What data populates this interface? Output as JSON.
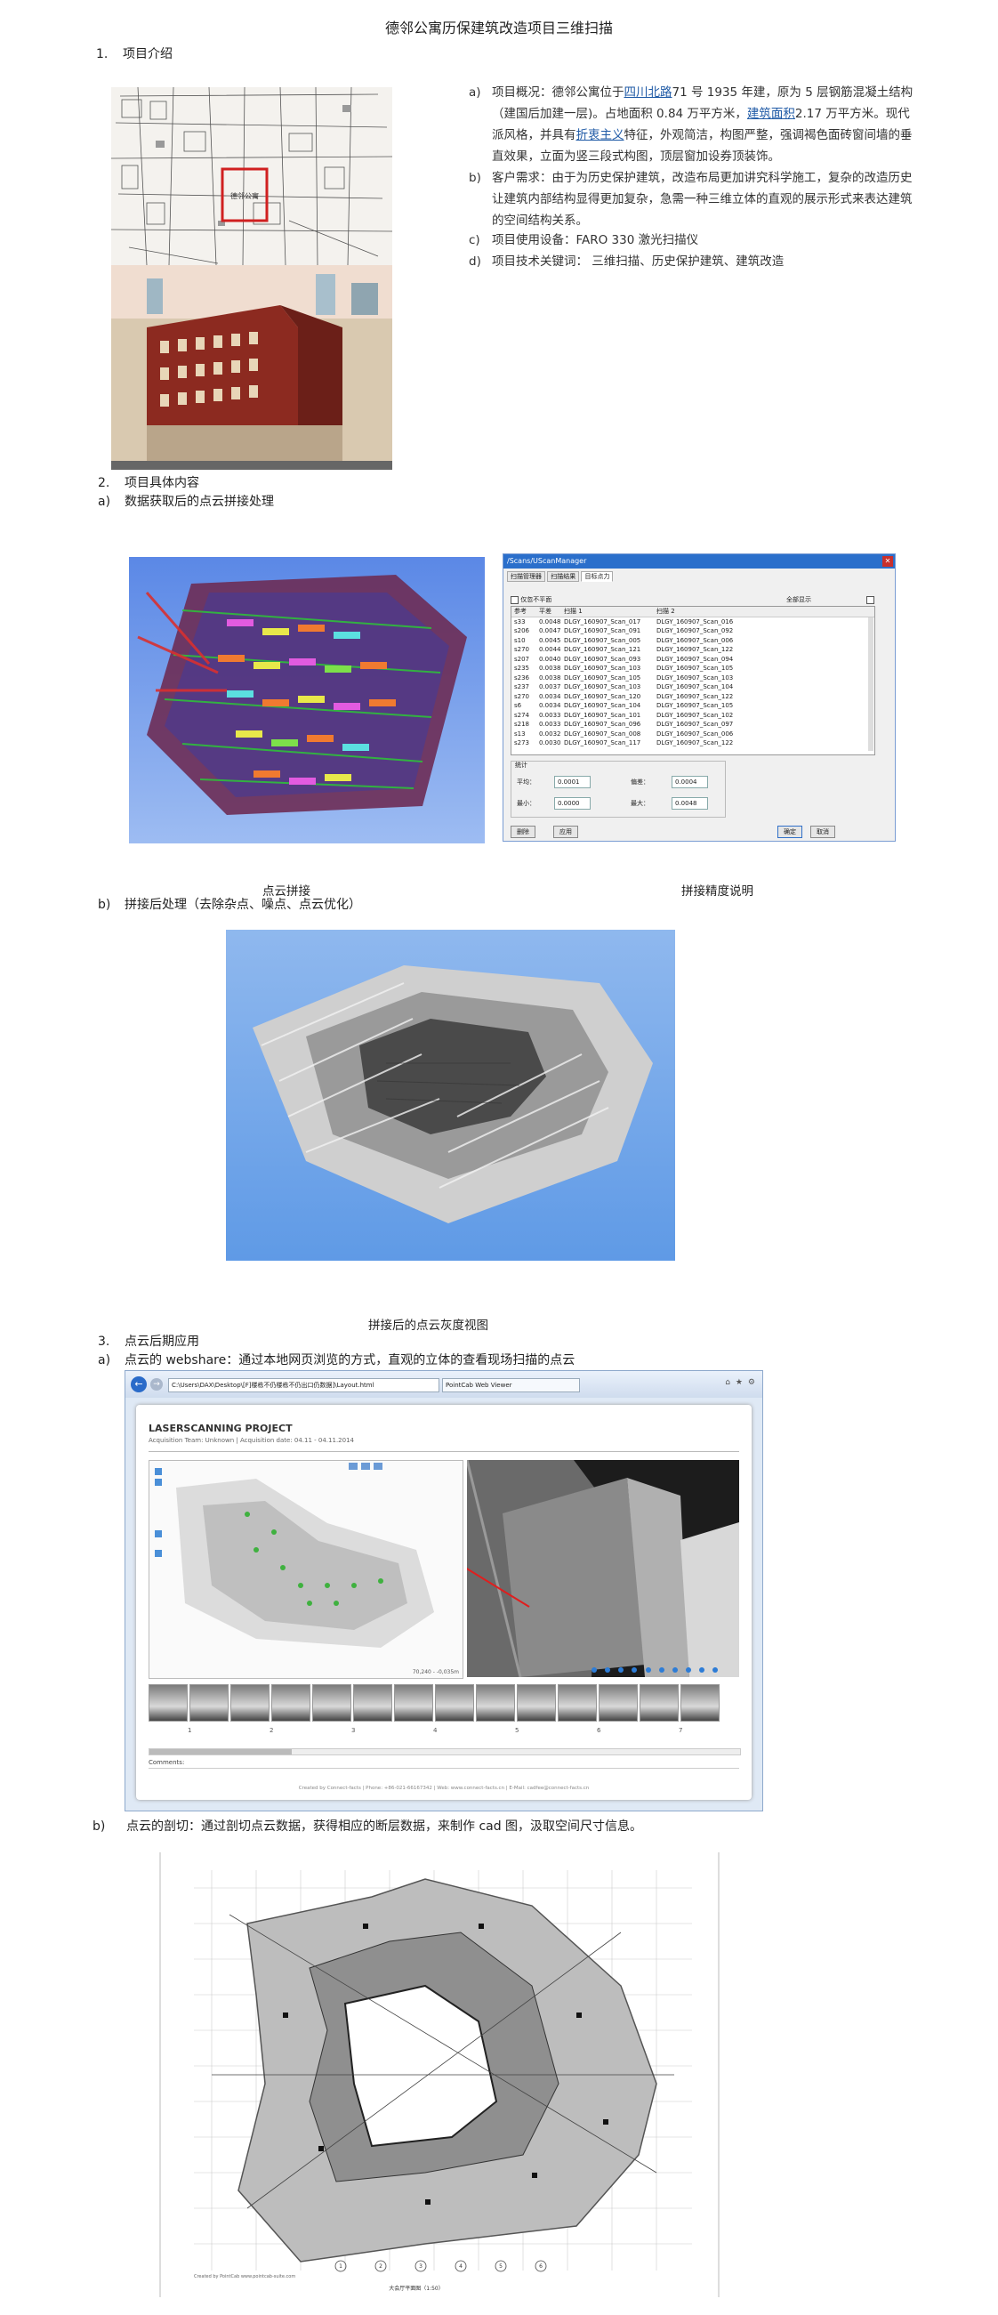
{
  "title": "德邻公寓历保建筑改造项目三维扫描",
  "section1": {
    "num": "1.",
    "heading": "项目介绍",
    "map_text": "德邻公寓",
    "items": [
      {
        "label": "a)",
        "pre": "项目概况：德邻公寓位于",
        "link1": "四川北路",
        "mid1": "71 号 1935 年建，原为 5 层钢筋混凝土结构（建国后加建一层)。占地面积 0.84 万平方米，",
        "link2": "建筑面积",
        "mid2": "2.17 万平方米。现代派风格，并具有",
        "link3": "折衷主义",
        "post": "特征，外观简洁，构图严整，强调褐色面砖窗间墙的垂直效果，立面为竖三段式构图，顶层窗加设券顶装饰。"
      },
      {
        "label": "b)",
        "text": "客户需求：由于为历史保护建筑，改造布局更加讲究科学施工，复杂的改造历史让建筑内部结构显得更加复杂，急需一种三维立体的直观的展示形式来表达建筑的空间结构关系。"
      },
      {
        "label": "c)",
        "text": "项目使用设备：FARO 330 激光扫描仪"
      },
      {
        "label": "d)",
        "text": "项目技术关键词： 三维扫描、历史保护建筑、建筑改造"
      }
    ]
  },
  "section2": {
    "num": "2.",
    "heading": "项目具体内容",
    "a_label": "a)",
    "a_text": "数据获取后的点云拼接处理",
    "caption_left": "点云拼接",
    "caption_right": "拼接精度说明",
    "b_label": "b)",
    "b_text": "拼接后处理（去除杂点、噪点、点云优化）",
    "caption_center": "拼接后的点云灰度视图"
  },
  "scan_manager": {
    "title": "/Scans/UScanManager",
    "tabs": [
      "扫描管理器",
      "扫描结果",
      "目标点力"
    ],
    "check_label": "仅忽不平面",
    "all_label": "全部显示",
    "columns": [
      "参考",
      "平差",
      "扫描 1",
      "扫描 2"
    ],
    "rows": [
      [
        "s33",
        "0.0048",
        "DLGY_160907_Scan_017",
        "DLGY_160907_Scan_016"
      ],
      [
        "s206",
        "0.0047",
        "DLGY_160907_Scan_091",
        "DLGY_160907_Scan_092"
      ],
      [
        "s10",
        "0.0045",
        "DLGY_160907_Scan_005",
        "DLGY_160907_Scan_006"
      ],
      [
        "s270",
        "0.0044",
        "DLGY_160907_Scan_121",
        "DLGY_160907_Scan_122"
      ],
      [
        "s207",
        "0.0040",
        "DLGY_160907_Scan_093",
        "DLGY_160907_Scan_094"
      ],
      [
        "s235",
        "0.0038",
        "DLGY_160907_Scan_103",
        "DLGY_160907_Scan_105"
      ],
      [
        "s236",
        "0.0038",
        "DLGY_160907_Scan_105",
        "DLGY_160907_Scan_103"
      ],
      [
        "s237",
        "0.0037",
        "DLGY_160907_Scan_103",
        "DLGY_160907_Scan_104"
      ],
      [
        "s270",
        "0.0034",
        "DLGY_160907_Scan_120",
        "DLGY_160907_Scan_122"
      ],
      [
        "s6",
        "0.0034",
        "DLGY_160907_Scan_104",
        "DLGY_160907_Scan_105"
      ],
      [
        "s274",
        "0.0033",
        "DLGY_160907_Scan_101",
        "DLGY_160907_Scan_102"
      ],
      [
        "s218",
        "0.0033",
        "DLGY_160907_Scan_096",
        "DLGY_160907_Scan_097"
      ],
      [
        "s13",
        "0.0032",
        "DLGY_160907_Scan_008",
        "DLGY_160907_Scan_006"
      ],
      [
        "s273",
        "0.0030",
        "DLGY_160907_Scan_117",
        "DLGY_160907_Scan_122"
      ]
    ],
    "stats_label": "统计",
    "avg_label": "平均：",
    "avg_value": "0.0001",
    "dev_label": "偏差：",
    "dev_value": "0.0004",
    "min_label": "最小：",
    "min_value": "0.0000",
    "max_label": "最大：",
    "max_value": "0.0048",
    "btn_delete": "删除",
    "btn_apply": "应用",
    "btn_ok": "确定",
    "btn_cancel": "取消"
  },
  "section3": {
    "num": "3.",
    "heading": "点云后期应用",
    "a_label": "a)",
    "a_text": "点云的 webshare：通过本地网页浏览的方式，直观的立体的查看现场扫描的点云",
    "b_label": "b)",
    "b_text": "点云的剖切：通过剖切点云数据，获得相应的断层数据，来制作 cad 图，汲取空间尺寸信息。"
  },
  "browser": {
    "address": "C:\\Users\\DAX\\Desktop\\[F]楼栋不仍楼栋不仍出口仍数据]\\Layout.html",
    "tab_label": "PointCab Web Viewer",
    "project_title": "LASERSCANNING PROJECT",
    "project_sub": "Acquisition Team: Unknown | Acquisition date: 04.11 - 04.11.2014",
    "coord_text": "70,240 - -0,035m",
    "thumb_numbers": [
      "1",
      "2",
      "3",
      "4",
      "5",
      "6",
      "7"
    ],
    "comments_label": "Comments:",
    "footer": "Created by Connect-facts | Phone: +86-021-66167342 | Web: www.connect-facts.cn | E-Mail: cadfee@connect-facts.cn"
  },
  "cad": {
    "stamp_text": "Created by PointCab www.pointcab-suite.com",
    "caption": "大会厅平面图（1:50）",
    "axis_labels": [
      "1",
      "2",
      "3",
      "4",
      "5",
      "6"
    ]
  }
}
